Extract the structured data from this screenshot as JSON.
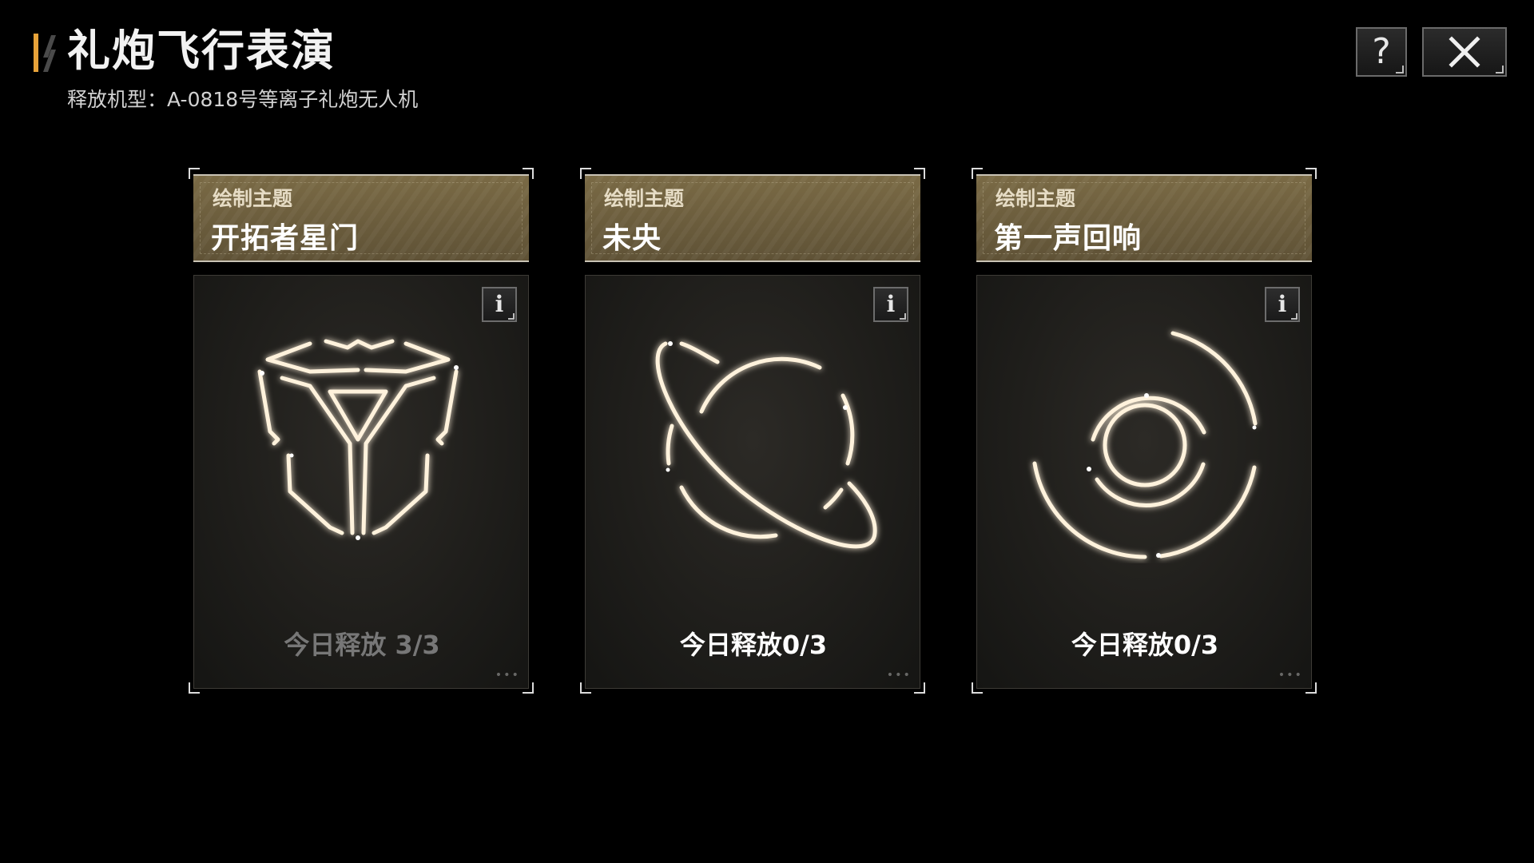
{
  "header": {
    "title": "礼炮飞行表演",
    "subtitle": "释放机型：A-0818号等离子礼炮无人机"
  },
  "buttons": {
    "help_icon": "question-icon",
    "close_icon": "close-icon"
  },
  "colors": {
    "accent": "#e8a33a",
    "card_header": "#6e6040",
    "glow": "#fff2dc",
    "glow_edge": "#d9a760",
    "released_text": "#777777"
  },
  "cards": [
    {
      "label": "绘制主题",
      "title": "开拓者星门",
      "release": "今日释放 3/3",
      "glyph": "pioneer-stargate-icon",
      "state": "done"
    },
    {
      "label": "绘制主题",
      "title": "未央",
      "release": "今日释放0/3",
      "glyph": "planet-ring-icon",
      "state": "active"
    },
    {
      "label": "绘制主题",
      "title": "第一声回响",
      "release": "今日释放0/3",
      "glyph": "concentric-circles-icon",
      "state": "active"
    }
  ]
}
